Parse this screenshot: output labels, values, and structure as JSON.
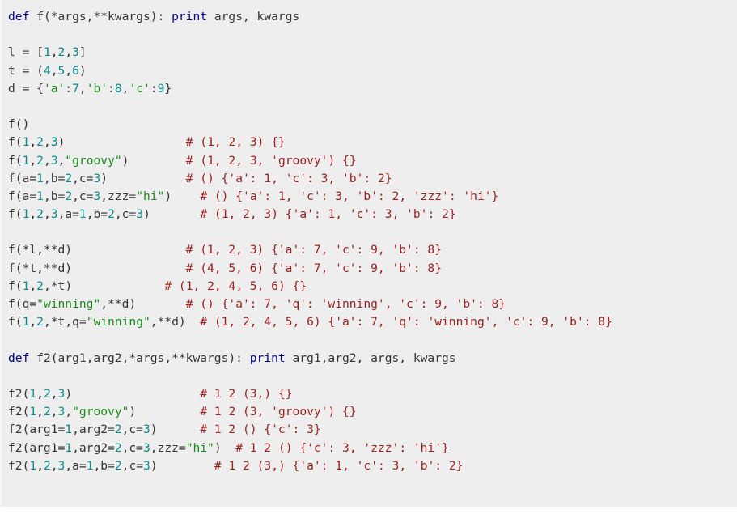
{
  "document": {
    "kind": "code-snippet",
    "language": "Python",
    "background_color": "#eeeeee",
    "page_background_color": "#ffffff"
  },
  "theme": {
    "keyword_color": "#00008b",
    "number_color": "#0a8b8b",
    "string_color": "#1a8b1a",
    "comment_color": "#9b2020",
    "identifier_color": "#333333",
    "background_color": "#eeeeee"
  },
  "code": {
    "lines": [
      {
        "id": "line-1",
        "tokens": [
          {
            "t": "def",
            "c": "kw"
          },
          {
            "t": " ",
            "c": "name"
          },
          {
            "t": "f(*args,**kwargs):",
            "c": "name"
          },
          {
            "t": " ",
            "c": "name"
          },
          {
            "t": "print",
            "c": "kw"
          },
          {
            "t": " args, kwargs",
            "c": "name"
          }
        ]
      },
      {
        "id": "line-2",
        "tokens": []
      },
      {
        "id": "line-3",
        "tokens": [
          {
            "t": "l = [",
            "c": "name"
          },
          {
            "t": "1",
            "c": "num"
          },
          {
            "t": ",",
            "c": "name"
          },
          {
            "t": "2",
            "c": "num"
          },
          {
            "t": ",",
            "c": "name"
          },
          {
            "t": "3",
            "c": "num"
          },
          {
            "t": "]",
            "c": "name"
          }
        ]
      },
      {
        "id": "line-4",
        "tokens": [
          {
            "t": "t = (",
            "c": "name"
          },
          {
            "t": "4",
            "c": "num"
          },
          {
            "t": ",",
            "c": "name"
          },
          {
            "t": "5",
            "c": "num"
          },
          {
            "t": ",",
            "c": "name"
          },
          {
            "t": "6",
            "c": "num"
          },
          {
            "t": ")",
            "c": "name"
          }
        ]
      },
      {
        "id": "line-5",
        "tokens": [
          {
            "t": "d = {",
            "c": "name"
          },
          {
            "t": "'a'",
            "c": "str"
          },
          {
            "t": ":",
            "c": "name"
          },
          {
            "t": "7",
            "c": "num"
          },
          {
            "t": ",",
            "c": "name"
          },
          {
            "t": "'b'",
            "c": "str"
          },
          {
            "t": ":",
            "c": "name"
          },
          {
            "t": "8",
            "c": "num"
          },
          {
            "t": ",",
            "c": "name"
          },
          {
            "t": "'c'",
            "c": "str"
          },
          {
            "t": ":",
            "c": "name"
          },
          {
            "t": "9",
            "c": "num"
          },
          {
            "t": "}",
            "c": "name"
          }
        ]
      },
      {
        "id": "line-6",
        "tokens": []
      },
      {
        "id": "line-7",
        "tokens": [
          {
            "t": "f()",
            "c": "name"
          }
        ]
      },
      {
        "id": "line-8",
        "tokens": [
          {
            "t": "f(",
            "c": "name"
          },
          {
            "t": "1",
            "c": "num"
          },
          {
            "t": ",",
            "c": "name"
          },
          {
            "t": "2",
            "c": "num"
          },
          {
            "t": ",",
            "c": "name"
          },
          {
            "t": "3",
            "c": "num"
          },
          {
            "t": ")",
            "c": "name"
          },
          {
            "t": "                 ",
            "c": "name"
          },
          {
            "t": "# (1, 2, 3) {}",
            "c": "cmt"
          }
        ]
      },
      {
        "id": "line-9",
        "tokens": [
          {
            "t": "f(",
            "c": "name"
          },
          {
            "t": "1",
            "c": "num"
          },
          {
            "t": ",",
            "c": "name"
          },
          {
            "t": "2",
            "c": "num"
          },
          {
            "t": ",",
            "c": "name"
          },
          {
            "t": "3",
            "c": "num"
          },
          {
            "t": ",",
            "c": "name"
          },
          {
            "t": "\"groovy\"",
            "c": "str"
          },
          {
            "t": ")",
            "c": "name"
          },
          {
            "t": "        ",
            "c": "name"
          },
          {
            "t": "# (1, 2, 3, 'groovy') {}",
            "c": "cmt"
          }
        ]
      },
      {
        "id": "line-10",
        "tokens": [
          {
            "t": "f(a=",
            "c": "name"
          },
          {
            "t": "1",
            "c": "num"
          },
          {
            "t": ",b=",
            "c": "name"
          },
          {
            "t": "2",
            "c": "num"
          },
          {
            "t": ",c=",
            "c": "name"
          },
          {
            "t": "3",
            "c": "num"
          },
          {
            "t": ")",
            "c": "name"
          },
          {
            "t": "           ",
            "c": "name"
          },
          {
            "t": "# () {'a': 1, 'c': 3, 'b': 2}",
            "c": "cmt"
          }
        ]
      },
      {
        "id": "line-11",
        "tokens": [
          {
            "t": "f(a=",
            "c": "name"
          },
          {
            "t": "1",
            "c": "num"
          },
          {
            "t": ",b=",
            "c": "name"
          },
          {
            "t": "2",
            "c": "num"
          },
          {
            "t": ",c=",
            "c": "name"
          },
          {
            "t": "3",
            "c": "num"
          },
          {
            "t": ",zzz=",
            "c": "name"
          },
          {
            "t": "\"hi\"",
            "c": "str"
          },
          {
            "t": ")",
            "c": "name"
          },
          {
            "t": "    ",
            "c": "name"
          },
          {
            "t": "# () {'a': 1, 'c': 3, 'b': 2, 'zzz': 'hi'}",
            "c": "cmt"
          }
        ]
      },
      {
        "id": "line-12",
        "tokens": [
          {
            "t": "f(",
            "c": "name"
          },
          {
            "t": "1",
            "c": "num"
          },
          {
            "t": ",",
            "c": "name"
          },
          {
            "t": "2",
            "c": "num"
          },
          {
            "t": ",",
            "c": "name"
          },
          {
            "t": "3",
            "c": "num"
          },
          {
            "t": ",a=",
            "c": "name"
          },
          {
            "t": "1",
            "c": "num"
          },
          {
            "t": ",b=",
            "c": "name"
          },
          {
            "t": "2",
            "c": "num"
          },
          {
            "t": ",c=",
            "c": "name"
          },
          {
            "t": "3",
            "c": "num"
          },
          {
            "t": ")",
            "c": "name"
          },
          {
            "t": "       ",
            "c": "name"
          },
          {
            "t": "# (1, 2, 3) {'a': 1, 'c': 3, 'b': 2}",
            "c": "cmt"
          }
        ]
      },
      {
        "id": "line-13",
        "tokens": []
      },
      {
        "id": "line-14",
        "tokens": [
          {
            "t": "f(*l,**d)",
            "c": "name"
          },
          {
            "t": "                ",
            "c": "name"
          },
          {
            "t": "# (1, 2, 3) {'a': 7, 'c': 9, 'b': 8}",
            "c": "cmt"
          }
        ]
      },
      {
        "id": "line-15",
        "tokens": [
          {
            "t": "f(*t,**d)",
            "c": "name"
          },
          {
            "t": "                ",
            "c": "name"
          },
          {
            "t": "# (4, 5, 6) {'a': 7, 'c': 9, 'b': 8}",
            "c": "cmt"
          }
        ]
      },
      {
        "id": "line-16",
        "tokens": [
          {
            "t": "f(",
            "c": "name"
          },
          {
            "t": "1",
            "c": "num"
          },
          {
            "t": ",",
            "c": "name"
          },
          {
            "t": "2",
            "c": "num"
          },
          {
            "t": ",*t)",
            "c": "name"
          },
          {
            "t": "             ",
            "c": "name"
          },
          {
            "t": "# (1, 2, 4, 5, 6) {}",
            "c": "cmt"
          }
        ]
      },
      {
        "id": "line-17",
        "tokens": [
          {
            "t": "f(q=",
            "c": "name"
          },
          {
            "t": "\"winning\"",
            "c": "str"
          },
          {
            "t": ",**d)",
            "c": "name"
          },
          {
            "t": "       ",
            "c": "name"
          },
          {
            "t": "# () {'a': 7, 'q': 'winning', 'c': 9, 'b': 8}",
            "c": "cmt"
          }
        ]
      },
      {
        "id": "line-18",
        "tokens": [
          {
            "t": "f(",
            "c": "name"
          },
          {
            "t": "1",
            "c": "num"
          },
          {
            "t": ",",
            "c": "name"
          },
          {
            "t": "2",
            "c": "num"
          },
          {
            "t": ",*t,q=",
            "c": "name"
          },
          {
            "t": "\"winning\"",
            "c": "str"
          },
          {
            "t": ",**d)",
            "c": "name"
          },
          {
            "t": "  ",
            "c": "name"
          },
          {
            "t": "# (1, 2, 4, 5, 6) {'a': 7, 'q': 'winning', 'c': 9, 'b': 8}",
            "c": "cmt"
          }
        ]
      },
      {
        "id": "line-19",
        "tokens": []
      },
      {
        "id": "line-20",
        "tokens": [
          {
            "t": "def",
            "c": "kw"
          },
          {
            "t": " f2(arg1,arg2,*args,**kwargs):",
            "c": "name"
          },
          {
            "t": " ",
            "c": "name"
          },
          {
            "t": "print",
            "c": "kw"
          },
          {
            "t": " arg1,arg2, args, kwargs",
            "c": "name"
          }
        ]
      },
      {
        "id": "line-21",
        "tokens": []
      },
      {
        "id": "line-22",
        "tokens": [
          {
            "t": "f2(",
            "c": "name"
          },
          {
            "t": "1",
            "c": "num"
          },
          {
            "t": ",",
            "c": "name"
          },
          {
            "t": "2",
            "c": "num"
          },
          {
            "t": ",",
            "c": "name"
          },
          {
            "t": "3",
            "c": "num"
          },
          {
            "t": ")",
            "c": "name"
          },
          {
            "t": "                  ",
            "c": "name"
          },
          {
            "t": "# 1 2 (3,) {}",
            "c": "cmt"
          }
        ]
      },
      {
        "id": "line-23",
        "tokens": [
          {
            "t": "f2(",
            "c": "name"
          },
          {
            "t": "1",
            "c": "num"
          },
          {
            "t": ",",
            "c": "name"
          },
          {
            "t": "2",
            "c": "num"
          },
          {
            "t": ",",
            "c": "name"
          },
          {
            "t": "3",
            "c": "num"
          },
          {
            "t": ",",
            "c": "name"
          },
          {
            "t": "\"groovy\"",
            "c": "str"
          },
          {
            "t": ")",
            "c": "name"
          },
          {
            "t": "         ",
            "c": "name"
          },
          {
            "t": "# 1 2 (3, 'groovy') {}",
            "c": "cmt"
          }
        ]
      },
      {
        "id": "line-24",
        "tokens": [
          {
            "t": "f2(arg1=",
            "c": "name"
          },
          {
            "t": "1",
            "c": "num"
          },
          {
            "t": ",arg2=",
            "c": "name"
          },
          {
            "t": "2",
            "c": "num"
          },
          {
            "t": ",c=",
            "c": "name"
          },
          {
            "t": "3",
            "c": "num"
          },
          {
            "t": ")",
            "c": "name"
          },
          {
            "t": "      ",
            "c": "name"
          },
          {
            "t": "# 1 2 () {'c': 3}",
            "c": "cmt"
          }
        ]
      },
      {
        "id": "line-25",
        "tokens": [
          {
            "t": "f2(arg1=",
            "c": "name"
          },
          {
            "t": "1",
            "c": "num"
          },
          {
            "t": ",arg2=",
            "c": "name"
          },
          {
            "t": "2",
            "c": "num"
          },
          {
            "t": ",c=",
            "c": "name"
          },
          {
            "t": "3",
            "c": "num"
          },
          {
            "t": ",zzz=",
            "c": "name"
          },
          {
            "t": "\"hi\"",
            "c": "str"
          },
          {
            "t": ")",
            "c": "name"
          },
          {
            "t": "  ",
            "c": "name"
          },
          {
            "t": "# 1 2 () {'c': 3, 'zzz': 'hi'}",
            "c": "cmt"
          }
        ]
      },
      {
        "id": "line-26",
        "tokens": [
          {
            "t": "f2(",
            "c": "name"
          },
          {
            "t": "1",
            "c": "num"
          },
          {
            "t": ",",
            "c": "name"
          },
          {
            "t": "2",
            "c": "num"
          },
          {
            "t": ",",
            "c": "name"
          },
          {
            "t": "3",
            "c": "num"
          },
          {
            "t": ",a=",
            "c": "name"
          },
          {
            "t": "1",
            "c": "num"
          },
          {
            "t": ",b=",
            "c": "name"
          },
          {
            "t": "2",
            "c": "num"
          },
          {
            "t": ",c=",
            "c": "name"
          },
          {
            "t": "3",
            "c": "num"
          },
          {
            "t": ")",
            "c": "name"
          },
          {
            "t": "        ",
            "c": "name"
          },
          {
            "t": "# 1 2 (3,) {'a': 1, 'c': 3, 'b': 2}",
            "c": "cmt"
          }
        ]
      }
    ],
    "plain_text": "def f(*args,**kwargs): print args, kwargs\n\nl = [1,2,3]\nt = (4,5,6)\nd = {'a':7,'b':8,'c':9}\n\nf()\nf(1,2,3)                 # (1, 2, 3) {}\nf(1,2,3,\"groovy\")        # (1, 2, 3, 'groovy') {}\nf(a=1,b=2,c=3)           # () {'a': 1, 'c': 3, 'b': 2}\nf(a=1,b=2,c=3,zzz=\"hi\")    # () {'a': 1, 'c': 3, 'b': 2, 'zzz': 'hi'}\nf(1,2,3,a=1,b=2,c=3)       # (1, 2, 3) {'a': 1, 'c': 3, 'b': 2}\n\nf(*l,**d)                # (1, 2, 3) {'a': 7, 'c': 9, 'b': 8}\nf(*t,**d)                # (4, 5, 6) {'a': 7, 'c': 9, 'b': 8}\nf(1,2,*t)                # (1, 2, 4, 5, 6) {}\nf(q=\"winning\",**d)       # () {'a': 7, 'q': 'winning', 'c': 9, 'b': 8}\nf(1,2,*t,q=\"winning\",**d)  # (1, 2, 4, 5, 6) {'a': 7, 'q': 'winning', 'c': 9, 'b': 8}\n\ndef f2(arg1,arg2,*args,**kwargs): print arg1,arg2, args, kwargs\n\nf2(1,2,3)                  # 1 2 (3,) {}\nf2(1,2,3,\"groovy\")         # 1 2 (3, 'groovy') {}\nf2(arg1=1,arg2=2,c=3)      # 1 2 () {'c': 3}\nf2(arg1=1,arg2=2,c=3,zzz=\"hi\")  # 1 2 () {'c': 3, 'zzz': 'hi'}\nf2(1,2,3,a=1,b=2,c=3)        # 1 2 (3,) {'a': 1, 'c': 3, 'b': 2}"
  }
}
